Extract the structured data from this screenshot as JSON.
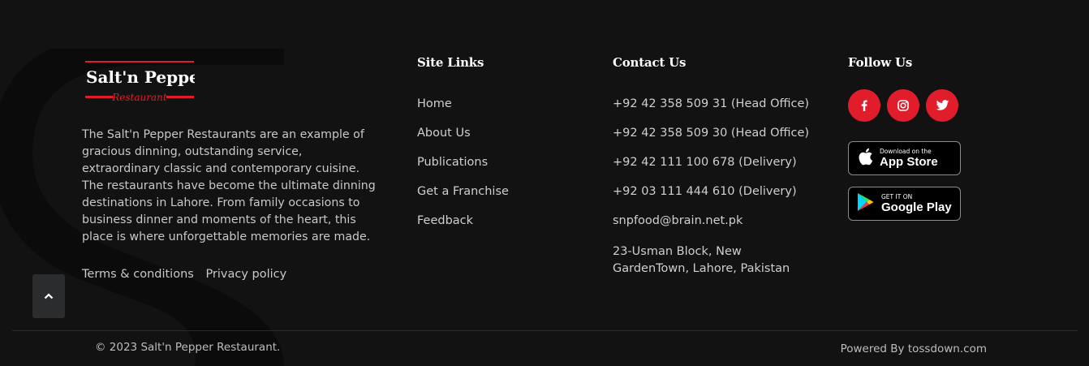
{
  "brand": {
    "logo_line1": "Salt'n Pepper",
    "logo_line2": "Restaurant",
    "accent_color": "#e11d2c"
  },
  "about_text": "The Salt'n Pepper Restaurants are an example of gracious dinning, outstanding service, extraordinary classic and contemporary cuisine. The restaurants have become the ultimate dinning destinations in Lahore. From family occasions to business dinner and moments of the heart, this place is where unforgettable memories are made.",
  "legal_links": [
    "Terms & conditions",
    "Privacy policy"
  ],
  "site_links": {
    "heading": "Site Links",
    "items": [
      "Home",
      "About Us",
      "Publications",
      "Get a Franchise",
      "Feedback"
    ]
  },
  "contact": {
    "heading": "Contact Us",
    "items": [
      "+92 42 358 509 31 (Head Office)",
      "+92 42 358 509 30 (Head Office)",
      "+92 42 111 100 678 (Delivery)",
      "+92 03 111 444 610 (Delivery)",
      "snpfood@brain.net.pk"
    ],
    "address": "23-Usman Block, New GardenTown, Lahore, Pakistan"
  },
  "follow": {
    "heading": "Follow Us",
    "socials": [
      "facebook-icon",
      "instagram-icon",
      "twitter-icon"
    ],
    "app_store": {
      "small": "Download on the",
      "big": "App Store"
    },
    "google_play": {
      "small": "GET IT ON",
      "big": "Google Play"
    }
  },
  "footer": {
    "copyright": "© 2023  Salt'n Pepper Restaurant.",
    "powered": "Powered By tossdown.com"
  }
}
